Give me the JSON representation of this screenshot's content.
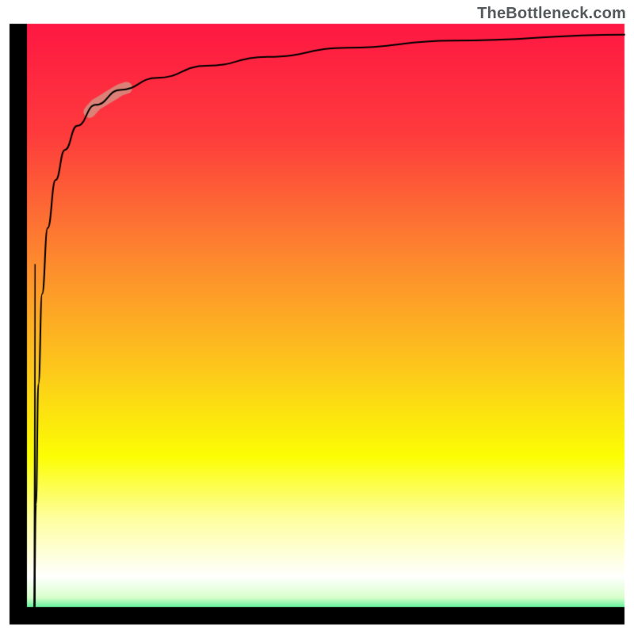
{
  "watermark": "TheBottleneck.com",
  "chart_data": {
    "type": "area",
    "title": "",
    "xlabel": "",
    "ylabel": "",
    "xlim": [
      0,
      100
    ],
    "ylim": [
      0,
      100
    ],
    "note": "No axis labels, ticks, or legend are present in the image. Values below are inferred via visual estimation (logarithmic-like curve, small highlighted region ~13–19% of x-range).",
    "background_gradient": {
      "orientation": "vertical",
      "stops": [
        {
          "pos": 0.0,
          "color": "#ff1843"
        },
        {
          "pos": 0.18,
          "color": "#fe3a3d"
        },
        {
          "pos": 0.4,
          "color": "#fd8c2e"
        },
        {
          "pos": 0.58,
          "color": "#fdca1b"
        },
        {
          "pos": 0.72,
          "color": "#fcfe04"
        },
        {
          "pos": 0.82,
          "color": "#feff9b"
        },
        {
          "pos": 0.92,
          "color": "#ffffff"
        },
        {
          "pos": 0.955,
          "color": "#d9ffcc"
        },
        {
          "pos": 0.985,
          "color": "#00e474"
        }
      ]
    },
    "curve": {
      "color": "#000000",
      "width": 2,
      "points": [
        {
          "x": 4.0,
          "y": 3
        },
        {
          "x": 4.3,
          "y": 20
        },
        {
          "x": 4.7,
          "y": 40
        },
        {
          "x": 5.3,
          "y": 55
        },
        {
          "x": 6.2,
          "y": 66
        },
        {
          "x": 7.5,
          "y": 74
        },
        {
          "x": 9.0,
          "y": 79
        },
        {
          "x": 11.0,
          "y": 83
        },
        {
          "x": 14.0,
          "y": 86.5
        },
        {
          "x": 18.0,
          "y": 89
        },
        {
          "x": 24.0,
          "y": 91
        },
        {
          "x": 32.0,
          "y": 93
        },
        {
          "x": 42.0,
          "y": 94.5
        },
        {
          "x": 55.0,
          "y": 96
        },
        {
          "x": 72.0,
          "y": 97.2
        },
        {
          "x": 100.0,
          "y": 98.2
        }
      ]
    },
    "highlight_segment": {
      "color": "#d68c7f",
      "opacity": 0.88,
      "width": 15,
      "x_start": 13.0,
      "x_end": 19.0
    },
    "left_spine": {
      "color": "#000000",
      "width": 22
    },
    "bottom_spine": {
      "color": "#000000",
      "width": 22
    }
  },
  "colors": {
    "watermark": "#555a5c"
  }
}
